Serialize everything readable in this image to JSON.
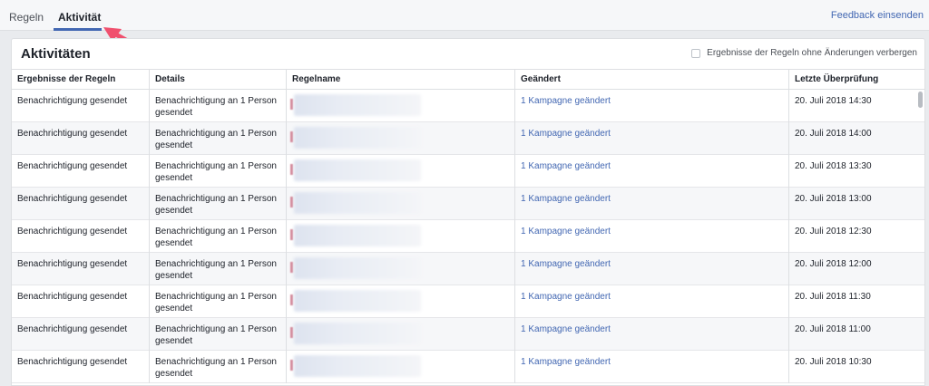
{
  "tabs": {
    "regeln": "Regeln",
    "aktivitaet": "Aktivität"
  },
  "feedback": "Feedback einsenden",
  "panel": {
    "title": "Aktivitäten",
    "filter_label": "Ergebnisse der Regeln ohne Änderungen verbergen"
  },
  "table": {
    "headers": [
      "Ergebnisse der Regeln",
      "Details",
      "Regelname",
      "Geändert",
      "Letzte Überprüfung"
    ],
    "rows": [
      {
        "result": "Benachrichtigung gesendet",
        "details": "Benachrichtigung an 1 Person gesendet",
        "changed": "1 Kampagne geändert",
        "checked": "20. Juli 2018 14:30"
      },
      {
        "result": "Benachrichtigung gesendet",
        "details": "Benachrichtigung an 1 Person gesendet",
        "changed": "1 Kampagne geändert",
        "checked": "20. Juli 2018 14:00"
      },
      {
        "result": "Benachrichtigung gesendet",
        "details": "Benachrichtigung an 1 Person gesendet",
        "changed": "1 Kampagne geändert",
        "checked": "20. Juli 2018 13:30"
      },
      {
        "result": "Benachrichtigung gesendet",
        "details": "Benachrichtigung an 1 Person gesendet",
        "changed": "1 Kampagne geändert",
        "checked": "20. Juli 2018 13:00"
      },
      {
        "result": "Benachrichtigung gesendet",
        "details": "Benachrichtigung an 1 Person gesendet",
        "changed": "1 Kampagne geändert",
        "checked": "20. Juli 2018 12:30"
      },
      {
        "result": "Benachrichtigung gesendet",
        "details": "Benachrichtigung an 1 Person gesendet",
        "changed": "1 Kampagne geändert",
        "checked": "20. Juli 2018 12:00"
      },
      {
        "result": "Benachrichtigung gesendet",
        "details": "Benachrichtigung an 1 Person gesendet",
        "changed": "1 Kampagne geändert",
        "checked": "20. Juli 2018 11:30"
      },
      {
        "result": "Benachrichtigung gesendet",
        "details": "Benachrichtigung an 1 Person gesendet",
        "changed": "1 Kampagne geändert",
        "checked": "20. Juli 2018 11:00"
      },
      {
        "result": "Benachrichtigung gesendet",
        "details": "Benachrichtigung an 1 Person gesendet",
        "changed": "1 Kampagne geändert",
        "checked": "20. Juli 2018 10:30"
      }
    ]
  },
  "colors": {
    "accent": "#4267b2",
    "annotation_arrow": "#f0506e"
  },
  "icons": {
    "annotation": "arrow-annotation-icon",
    "filter": "checkbox-icon"
  }
}
